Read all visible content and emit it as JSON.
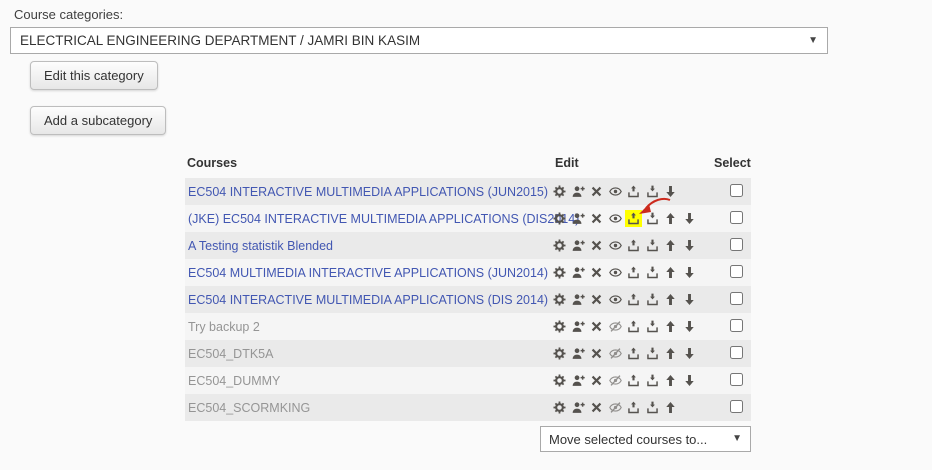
{
  "category_selector": {
    "label": "Course categories:",
    "selected": "ELECTRICAL ENGINEERING DEPARTMENT / JAMRI BIN KASIM"
  },
  "actions": {
    "edit_category_label": "Edit this category",
    "add_subcategory_label": "Add a subcategory"
  },
  "table": {
    "headers": {
      "courses": "Courses",
      "edit": "Edit",
      "select": "Select"
    },
    "rows": [
      {
        "name": "EC504 INTERACTIVE MULTIMEDIA APPLICATIONS (JUN2015)",
        "hidden": false,
        "checked": false,
        "icons": [
          "settings",
          "assign-roles",
          "delete",
          "hide",
          "backup",
          "restore",
          "move-down"
        ]
      },
      {
        "name": "(JKE) EC504 INTERACTIVE MULTIMEDIA APPLICATIONS (DIS2014)",
        "hidden": false,
        "checked": false,
        "icons": [
          "settings",
          "assign-roles",
          "delete",
          "hide",
          "backup",
          "restore",
          "move-up",
          "move-down"
        ],
        "highlight_icon": "backup",
        "annotation": "red-arrow"
      },
      {
        "name": "A Testing statistik Blended",
        "hidden": false,
        "checked": false,
        "icons": [
          "settings",
          "assign-roles",
          "delete",
          "hide",
          "backup",
          "restore",
          "move-up",
          "move-down"
        ]
      },
      {
        "name": "EC504 MULTIMEDIA INTERACTIVE APPLICATIONS (JUN2014)",
        "hidden": false,
        "checked": false,
        "icons": [
          "settings",
          "assign-roles",
          "delete",
          "hide",
          "backup",
          "restore",
          "move-up",
          "move-down"
        ]
      },
      {
        "name": "EC504 INTERACTIVE MULTIMEDIA APPLICATIONS (DIS 2014)",
        "hidden": false,
        "checked": false,
        "icons": [
          "settings",
          "assign-roles",
          "delete",
          "hide",
          "backup",
          "restore",
          "move-up",
          "move-down"
        ]
      },
      {
        "name": "Try backup 2",
        "hidden": true,
        "checked": false,
        "icons": [
          "settings",
          "assign-roles",
          "delete",
          "show",
          "backup",
          "restore",
          "move-up",
          "move-down"
        ]
      },
      {
        "name": "EC504_DTK5A",
        "hidden": true,
        "checked": false,
        "icons": [
          "settings",
          "assign-roles",
          "delete",
          "show",
          "backup",
          "restore",
          "move-up",
          "move-down"
        ]
      },
      {
        "name": "EC504_DUMMY",
        "hidden": true,
        "checked": false,
        "icons": [
          "settings",
          "assign-roles",
          "delete",
          "show",
          "backup",
          "restore",
          "move-up",
          "move-down"
        ]
      },
      {
        "name": "EC504_SCORMKING",
        "hidden": true,
        "checked": false,
        "icons": [
          "settings",
          "assign-roles",
          "delete",
          "show",
          "backup",
          "restore",
          "move-up"
        ]
      }
    ]
  },
  "move_dropdown": {
    "label": "Move selected courses to..."
  },
  "colors": {
    "link": "#4257b2",
    "hidden_link": "#959595",
    "icon": "#55524e",
    "highlight": "#ffff00",
    "annotation_arrow": "#cc2a1d"
  }
}
